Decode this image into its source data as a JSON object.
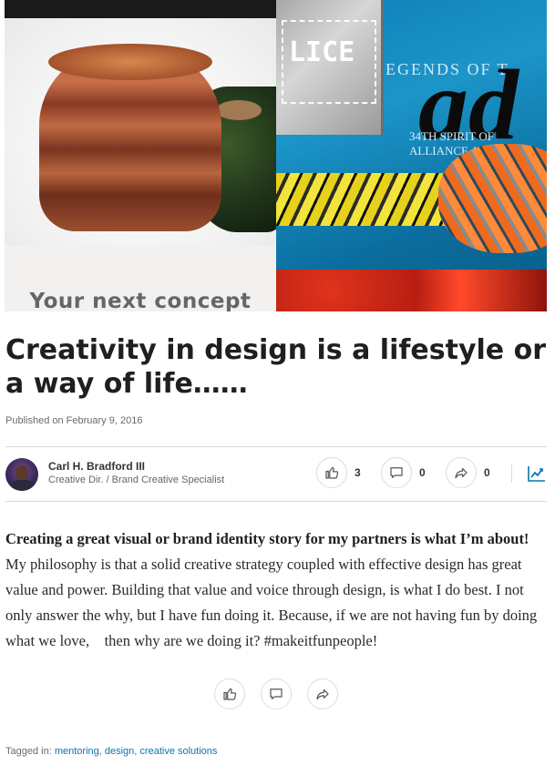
{
  "hero": {
    "left_caption": "Your next concept",
    "metal_text": "LICE",
    "legend_text": "EGENDS OF T",
    "ad_text": "ad",
    "spirit_text": "34TH SPIRIT OF ALLIANCE A"
  },
  "article": {
    "title": "Creativity in design is a lifestyle or a way of life……",
    "published": "Published on February 9, 2016"
  },
  "author": {
    "name": "Carl H. Bradford III",
    "role": "Creative Dir. / Brand Creative Specialist"
  },
  "actions": {
    "likes": "3",
    "comments": "0",
    "shares": "0"
  },
  "body": {
    "lead": "Creating a great visual or brand identity story for my partners is what I’m about!",
    "rest": " My philosophy is that a solid creative strategy coupled with effective design has great value and power. Building that value and voice through design, is what I do best. I not only answer the why, but I have fun doing it. Because, if we are not having fun by doing what we love,    then why are we doing it? #makeitfunpeople!"
  },
  "tags": {
    "prefix": "Tagged in: ",
    "items": [
      "mentoring",
      "design",
      "creative solutions"
    ],
    "separator": ", "
  },
  "colors": {
    "link": "#0a73b2",
    "title": "#1f1f1f"
  }
}
